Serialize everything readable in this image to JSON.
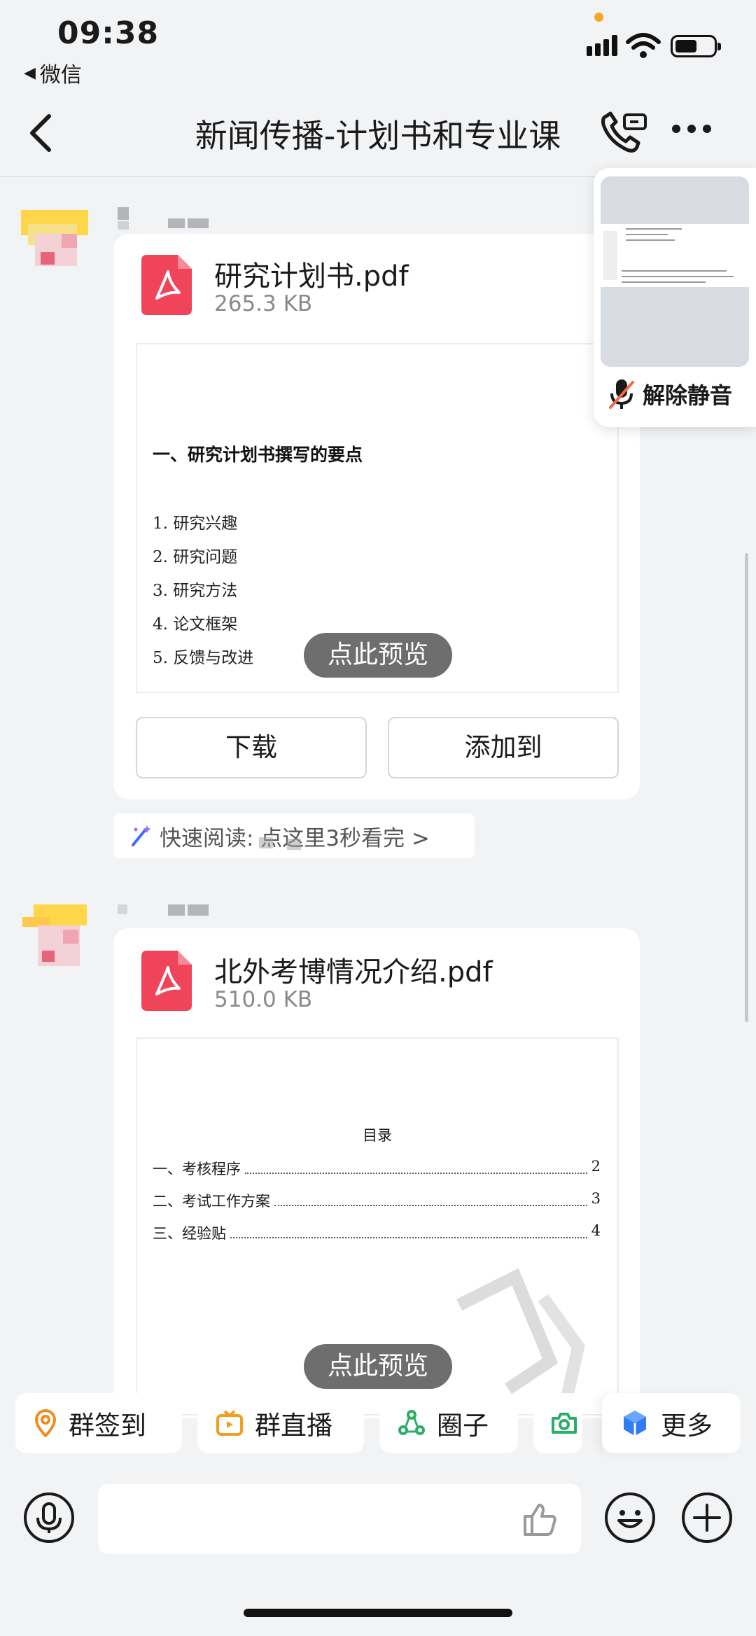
{
  "status_bar": {
    "time": "09:38",
    "back_app_label": "微信"
  },
  "nav": {
    "title": "新闻传播-计划书和专业课"
  },
  "floating_window": {
    "mute_label": "解除静音"
  },
  "messages": [
    {
      "file_name": "研究计划书.pdf",
      "file_size": "265.3 KB",
      "preview": {
        "heading": "一、研究计划书撰写的要点",
        "items": [
          "1. 研究兴趣",
          "2. 研究问题",
          "3. 研究方法",
          "4. 论文框架",
          "5. 反馈与改进"
        ]
      },
      "preview_label": "点此预览",
      "download_label": "下载",
      "add_to_label": "添加到",
      "quick_read": "快速阅读: 点这里3秒看完 >"
    },
    {
      "file_name": "北外考博情况介绍.pdf",
      "file_size": "510.0 KB",
      "preview": {
        "toc_title": "目录",
        "toc": [
          {
            "label": "一、考核程序",
            "page": "2"
          },
          {
            "label": "二、考试工作方案",
            "page": "3"
          },
          {
            "label": "三、经验贴",
            "page": "4"
          }
        ]
      },
      "preview_label": "点此预览"
    }
  ],
  "quick_actions": [
    "群签到",
    "群直播",
    "圈子",
    "",
    "更多"
  ],
  "colors": {
    "background": "#f2f3f5",
    "pdf_red": "#f0445a",
    "checkin_orange": "#f08c1e",
    "live_orange": "#f0a01e",
    "circle_green": "#2aae67",
    "more_blue": "#2f7cf6"
  }
}
